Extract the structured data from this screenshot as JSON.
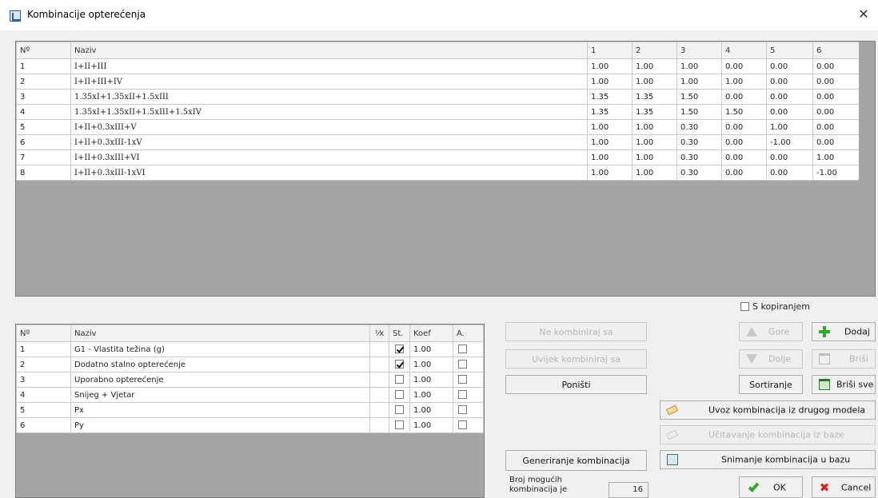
{
  "window": {
    "title": "Kombinacije opterećenja",
    "close_glyph": "✕",
    "icon": "app-icon"
  },
  "top_table": {
    "headers": [
      "Nº",
      "Naziv",
      "1",
      "2",
      "3",
      "4",
      "5",
      "6"
    ],
    "rows": [
      [
        "1",
        "I+II+III",
        "1.00",
        "1.00",
        "1.00",
        "0.00",
        "0.00",
        "0.00"
      ],
      [
        "2",
        "I+II+III+IV",
        "1.00",
        "1.00",
        "1.00",
        "1.00",
        "0.00",
        "0.00"
      ],
      [
        "3",
        "1.35xI+1.35xII+1.5xIII",
        "1.35",
        "1.35",
        "1.50",
        "0.00",
        "0.00",
        "0.00"
      ],
      [
        "4",
        "1.35xI+1.35xII+1.5xIII+1.5xIV",
        "1.35",
        "1.35",
        "1.50",
        "1.50",
        "0.00",
        "0.00"
      ],
      [
        "5",
        "I+II+0.3xIII+V",
        "1.00",
        "1.00",
        "0.30",
        "0.00",
        "1.00",
        "0.00"
      ],
      [
        "6",
        "I+II+0.3xIII-1xV",
        "1.00",
        "1.00",
        "0.30",
        "0.00",
        "-1.00",
        "0.00"
      ],
      [
        "7",
        "I+II+0.3xIII+VI",
        "1.00",
        "1.00",
        "0.30",
        "0.00",
        "0.00",
        "1.00"
      ],
      [
        "8",
        "I+II+0.3xIII-1xVI",
        "1.00",
        "1.00",
        "0.30",
        "0.00",
        "0.00",
        "-1.00"
      ]
    ]
  },
  "bottom_table": {
    "headers": [
      "Nº",
      "Naziv",
      "⅟x",
      "St.",
      "Koef",
      "A."
    ],
    "rows": [
      {
        "no": "1",
        "naziv": "G1 - Vlastita težina (g)",
        "st": true,
        "koef": "1.00",
        "a": false
      },
      {
        "no": "2",
        "naziv": "Dodatno stalno opterećenje",
        "st": true,
        "koef": "1.00",
        "a": false
      },
      {
        "no": "3",
        "naziv": "Uporabno opterećenje",
        "st": false,
        "koef": "1.00",
        "a": false
      },
      {
        "no": "4",
        "naziv": "Snijeg + Vjetar",
        "st": false,
        "koef": "1.00",
        "a": false
      },
      {
        "no": "5",
        "naziv": "Px",
        "st": false,
        "koef": "1.00",
        "a": false
      },
      {
        "no": "6",
        "naziv": "Py",
        "st": false,
        "koef": "1.00",
        "a": false
      }
    ]
  },
  "options": {
    "s_kopiranjem_label": "S kopiranjem",
    "s_kopiranjem_checked": false
  },
  "buttons": {
    "ne_kombiniraj": "Ne kombiniraj sa",
    "uvijek_kombiniraj": "Uvijek kombiniraj sa",
    "ponisti": "Poništi",
    "generiranje": "Generiranje kombinacija",
    "gore": "Gore",
    "dolje": "Dolje",
    "dodaj": "Dodaj",
    "brisi": "Briši",
    "sortiranje": "Sortiranje",
    "brisi_sve": "Briši sve",
    "uvoz": "Uvoz kombinacija iz drugog modela",
    "ucitavanje": "Učitavanje kombinacija iz baze",
    "snimanje": "Snimanje kombinacija u bazu",
    "ok": "OK",
    "cancel": "Cancel"
  },
  "status": {
    "broj_label_line1": "Broj mogućih",
    "broj_label_line2": "kombinacija je",
    "broj_value": "16"
  },
  "colors": {
    "accent_green": "#2eab2e",
    "cancel_red": "#dd2222",
    "grid_background": "#a5a5a5"
  }
}
